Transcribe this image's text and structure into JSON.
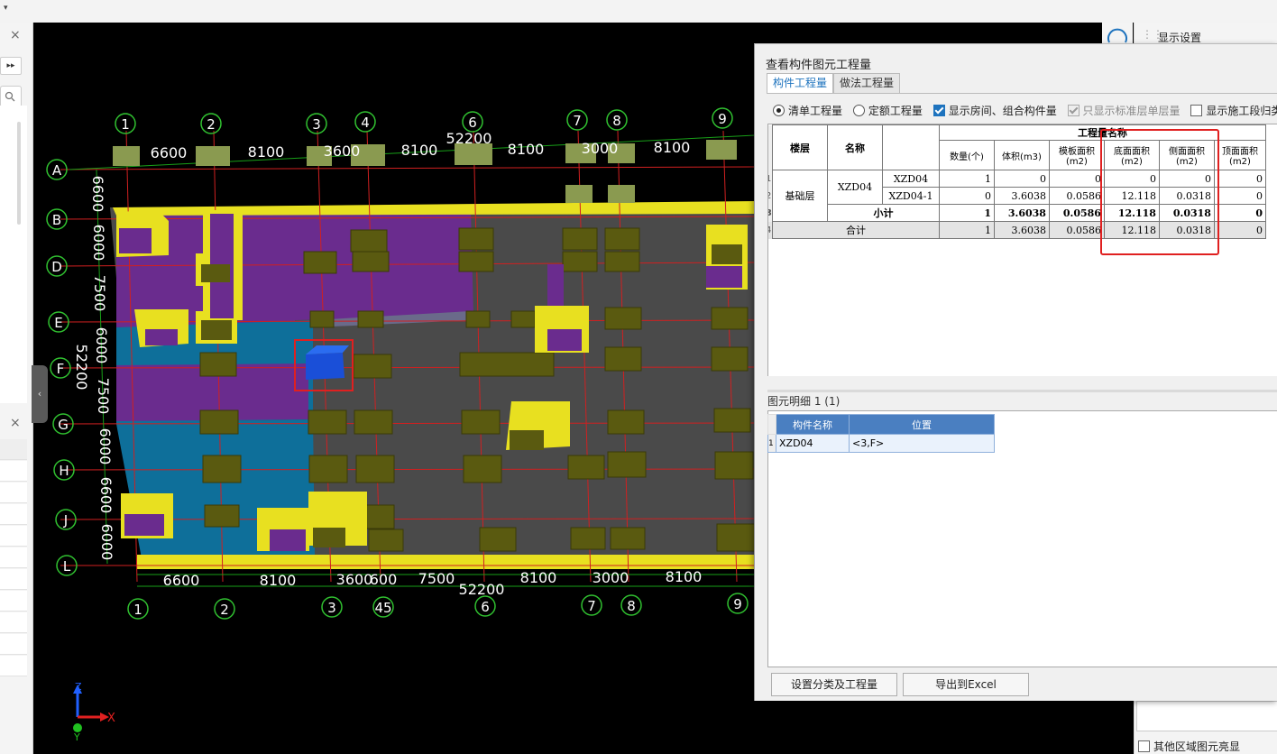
{
  "left_panel": {
    "close_glyph": "×",
    "expand_glyph": "▸▸",
    "search_icon": "search-icon",
    "close2_glyph": "×",
    "collapse_glyph": "‹"
  },
  "viewport": {
    "top_dimensions": [
      "6600",
      "8100",
      "3600",
      "8100",
      "52200",
      "8100",
      "3000",
      "8100"
    ],
    "bottom_dimensions": [
      "6600",
      "8100",
      "3600",
      "600",
      "7500",
      "52200",
      "8100",
      "3000",
      "8100"
    ],
    "left_dimensions": [
      "6600",
      "6000",
      "7500",
      "6000",
      "52200",
      "7500",
      "6000",
      "6600",
      "6000"
    ],
    "column_axes_top": [
      "1",
      "2",
      "3",
      "4",
      "6",
      "7",
      "8",
      "9"
    ],
    "column_axes_bottom": [
      "1",
      "2",
      "3",
      "45",
      "6",
      "7",
      "8",
      "9"
    ],
    "row_axes": [
      "A",
      "B",
      "D",
      "E",
      "F",
      "G",
      "H",
      "J",
      "L"
    ],
    "axis_x": "X",
    "axis_z": "Z",
    "axis_y": "Y"
  },
  "right_panel": {
    "title": "显示设置",
    "grip_glyph": "⋮⋮",
    "bottom_checkbox": "其他区域图元亮显"
  },
  "dialog": {
    "title": "查看构件图元工程量",
    "tabs": [
      "构件工程量",
      "做法工程量"
    ],
    "options": {
      "radio_list": "清单工程量",
      "radio_quota": "定额工程量",
      "chk_rooms": "显示房间、组合构件量",
      "chk_standard": "只显示标准层单层量",
      "chk_stage": "显示施工段归类"
    },
    "table": {
      "header_group": "工程量名称",
      "col_floor": "楼层",
      "col_name": "名称",
      "col_count": "数量(个)",
      "col_volume": "体积(m3)",
      "col_formwork": "模板面积(m2)",
      "col_bottom": "底面面积(m2)",
      "col_side": "侧面面积(m2)",
      "col_top": "顶面面积(m2)",
      "row_nums": [
        "1",
        "2",
        "3",
        "4"
      ],
      "floor": "基础层",
      "name": "XZD04",
      "rows": [
        {
          "sub": "XZD04",
          "count": "1",
          "volume": "0",
          "formwork": "0",
          "bottom": "0",
          "side": "0",
          "top": "0"
        },
        {
          "sub": "XZD04-1",
          "count": "0",
          "volume": "3.6038",
          "formwork": "0.0586",
          "bottom": "12.118",
          "side": "0.0318",
          "top": "0"
        }
      ],
      "subtotal": {
        "label": "小计",
        "count": "1",
        "volume": "3.6038",
        "formwork": "0.0586",
        "bottom": "12.118",
        "side": "0.0318",
        "top": "0"
      },
      "total": {
        "label": "合计",
        "count": "1",
        "volume": "3.6038",
        "formwork": "0.0586",
        "bottom": "12.118",
        "side": "0.0318",
        "top": "0"
      }
    },
    "detail": {
      "label": "图元明细 1 (1)",
      "col_name": "构件名称",
      "col_pos": "位置",
      "row_num": "1",
      "name": "XZD04",
      "pos": "<3,F>"
    },
    "buttons": {
      "set_category": "设置分类及工程量",
      "export": "导出到Excel"
    }
  }
}
